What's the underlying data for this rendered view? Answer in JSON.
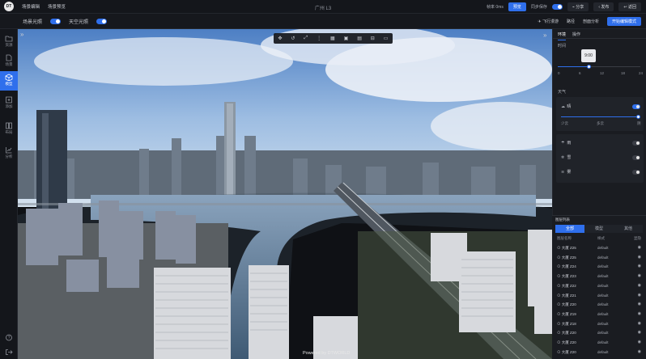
{
  "app": {
    "menu": [
      "场景编辑",
      "场景预览"
    ],
    "title": "广州 L3",
    "status": {
      "label": "帧率 0ms",
      "button": "预览",
      "option": "同步保存"
    },
    "actions": {
      "share": "分享",
      "publish": "发布",
      "back": "返回"
    }
  },
  "subbar": {
    "left": [
      {
        "label": "场景光照",
        "on": true
      },
      {
        "label": "天空光照",
        "on": true
      }
    ],
    "right": [
      "飞行漫游",
      "路径",
      "剖面分析",
      "开始编辑模式"
    ]
  },
  "sidebar": [
    {
      "icon": "folder-icon",
      "label": "资源"
    },
    {
      "icon": "document-icon",
      "label": "场景"
    },
    {
      "icon": "cube-icon",
      "label": "模型",
      "active": true
    },
    {
      "icon": "add-icon",
      "label": "添加"
    },
    {
      "icon": "layout-icon",
      "label": "布局"
    },
    {
      "icon": "chart-icon",
      "label": "分析"
    },
    {
      "icon": "help-icon",
      "label": ""
    },
    {
      "icon": "exit-icon",
      "label": ""
    }
  ],
  "toolbar": [
    "✥",
    "↺",
    "⤢",
    "⋮",
    "▦",
    "▣",
    "▤",
    "⊟",
    "▭"
  ],
  "powered": "Powered by DTWORLD",
  "panel": {
    "tabs": [
      "环境",
      "操作"
    ],
    "time_label": "时间",
    "time_tooltip": "9:00",
    "time_value": 9,
    "time_ticks": [
      "0",
      "6",
      "12",
      "18",
      "24"
    ],
    "weather_label": "天气",
    "weather_main": {
      "label": "晴",
      "on": true
    },
    "weather_ticks": [
      "少云",
      "多云",
      "阴"
    ],
    "weather_items": [
      {
        "label": "雨",
        "on": false
      },
      {
        "label": "雪",
        "on": false
      },
      {
        "label": "雾",
        "on": false
      }
    ]
  },
  "layers": {
    "header": "图层列表",
    "tabs": [
      "全部",
      "模型",
      "其他"
    ],
    "columns": {
      "name": "图层名称",
      "style": "样式",
      "action": "显隐"
    },
    "rows": [
      {
        "name": "大厦 Z25",
        "style": "default"
      },
      {
        "name": "大厦 Z25",
        "style": "default"
      },
      {
        "name": "大厦 Z24",
        "style": "default"
      },
      {
        "name": "大厦 Z23",
        "style": "default"
      },
      {
        "name": "大厦 Z22",
        "style": "default"
      },
      {
        "name": "大厦 Z21",
        "style": "default"
      },
      {
        "name": "大厦 Z20",
        "style": "default"
      },
      {
        "name": "大厦 Z19",
        "style": "default"
      },
      {
        "name": "大厦 Z18",
        "style": "default"
      },
      {
        "name": "大厦 Z20",
        "style": "default"
      },
      {
        "name": "大厦 Z20",
        "style": "default"
      },
      {
        "name": "大厦 Z20",
        "style": "default"
      }
    ]
  },
  "colors": {
    "accent": "#2f6fec",
    "panel": "#1a1c21",
    "topbar": "#14161b"
  }
}
